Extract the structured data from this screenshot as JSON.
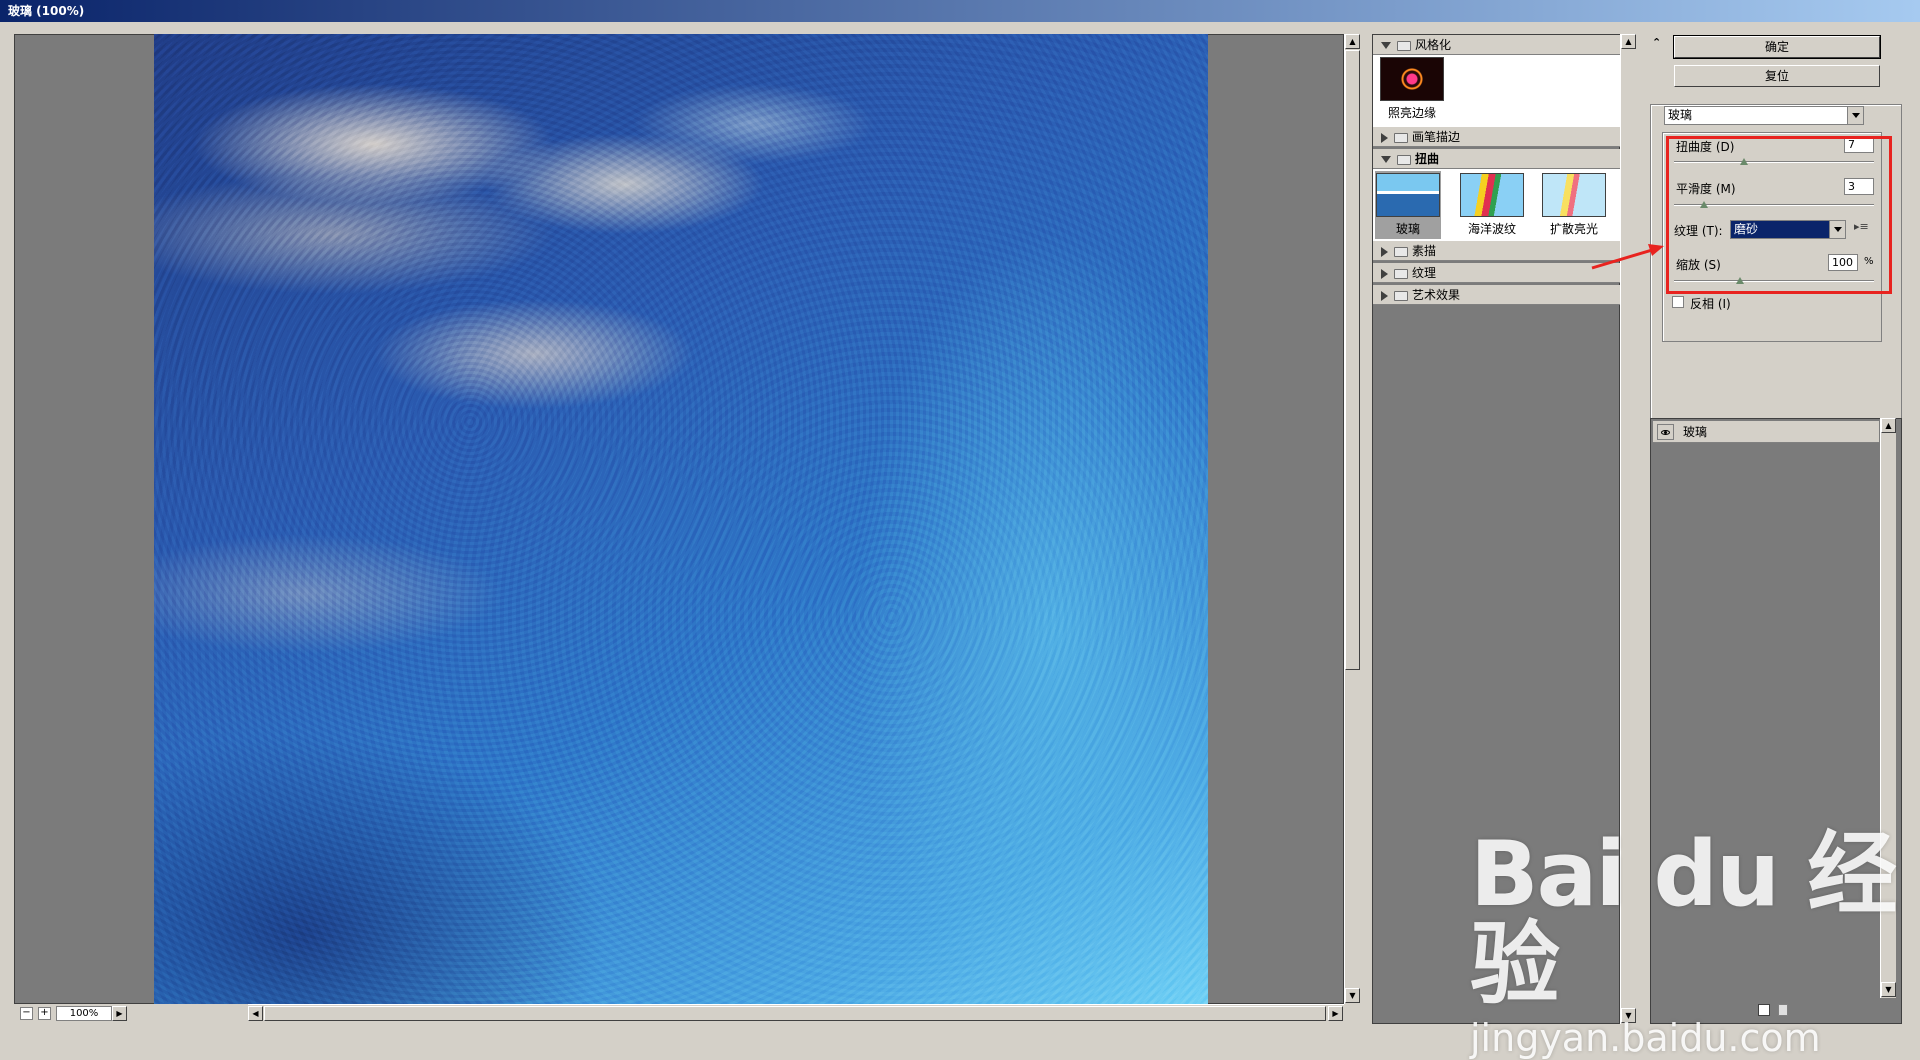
{
  "window": {
    "title": "玻璃 (100%)"
  },
  "preview": {
    "zoom": "100%"
  },
  "filter_gallery": {
    "categories": [
      {
        "label": "风格化",
        "expanded": true,
        "thumbnails": [
          {
            "label": "照亮边缘"
          }
        ]
      },
      {
        "label": "画笔描边",
        "expanded": false
      },
      {
        "label": "扭曲",
        "expanded": true,
        "thumbnails": [
          {
            "label": "玻璃",
            "selected": true
          },
          {
            "label": "海洋波纹"
          },
          {
            "label": "扩散亮光"
          }
        ]
      },
      {
        "label": "素描",
        "expanded": false
      },
      {
        "label": "纹理",
        "expanded": false
      },
      {
        "label": "艺术效果",
        "expanded": false
      }
    ]
  },
  "settings": {
    "ok_label": "确定",
    "reset_label": "复位",
    "filter_select": "玻璃",
    "distortion": {
      "label": "扭曲度 (D)",
      "value": "7",
      "level": 0.35
    },
    "smoothness": {
      "label": "平滑度 (M)",
      "value": "3",
      "level": 0.15
    },
    "texture": {
      "label": "纹理 (T):",
      "value": "磨砂"
    },
    "scaling": {
      "label": "缩放 (S)",
      "value": "100",
      "unit": "%",
      "level": 0.33
    },
    "invert": {
      "label": "反相 (I)",
      "checked": false
    }
  },
  "layers": {
    "items": [
      {
        "label": "玻璃"
      }
    ]
  },
  "watermark": {
    "logo": "Bai du 经验",
    "url": "jingyan.baidu.com"
  },
  "colors": {
    "highlight": "#e8231f",
    "title_bar": "#0a246a",
    "panel": "#d4d0c8",
    "well": "#7b7b7b"
  }
}
